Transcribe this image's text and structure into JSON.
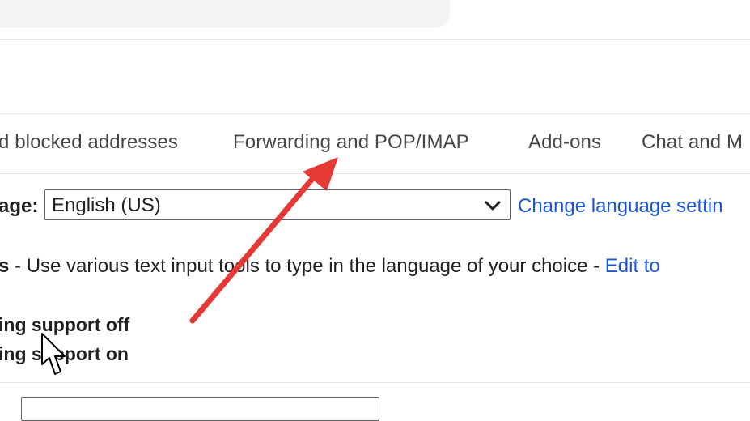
{
  "settings_tabs": [
    {
      "label": "d blocked addresses"
    },
    {
      "label": "Forwarding and POP/IMAP"
    },
    {
      "label": "Add-ons"
    },
    {
      "label": "Chat and M"
    }
  ],
  "language": {
    "label": "age:",
    "selected_value": "English (US)",
    "change_link": "Change language settin"
  },
  "input_tools": {
    "label": "s",
    "description": " - Use various text input tools to type in the language of your choice - ",
    "edit_link": "Edit to"
  },
  "rtl_options": [
    {
      "label": "ing support off"
    },
    {
      "label": "ing support on"
    }
  ],
  "annotation": {
    "arrow_color": "#e53935"
  },
  "colors": {
    "link": "#1a57d6",
    "tab_text": "#444746",
    "arrow": "#e53935"
  }
}
